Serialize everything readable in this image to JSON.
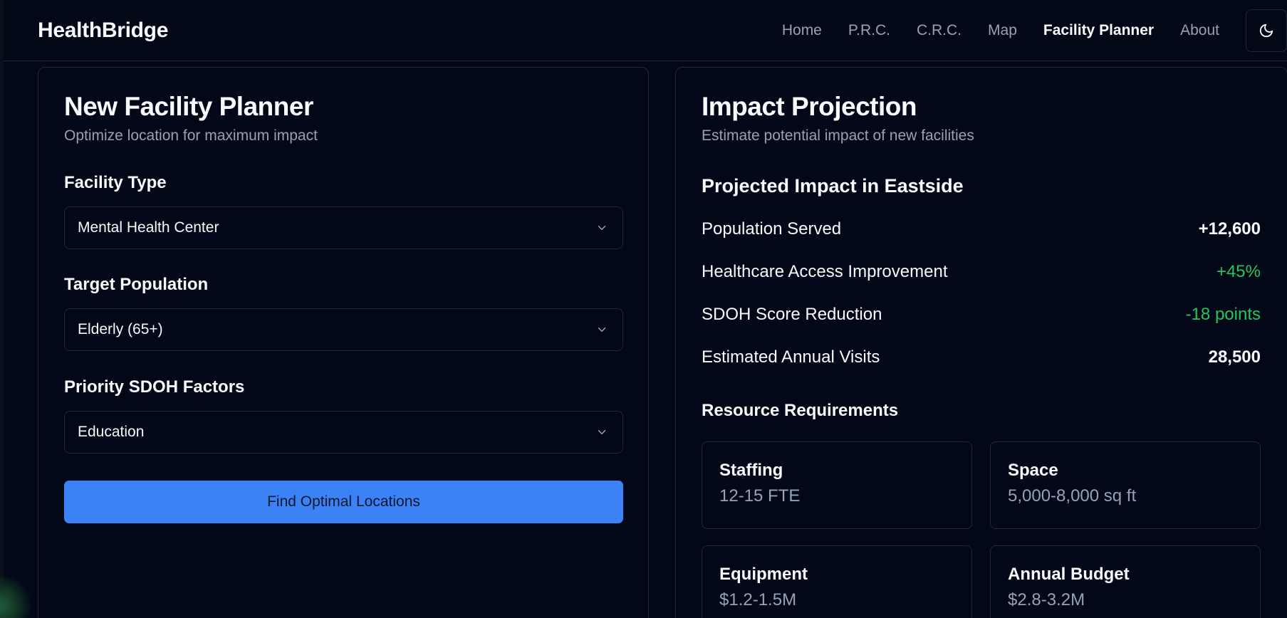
{
  "brand": "HealthBridge",
  "nav": {
    "items": [
      "Home",
      "P.R.C.",
      "C.R.C.",
      "Map",
      "Facility Planner",
      "About"
    ],
    "active": "Facility Planner"
  },
  "theme_toggle_icon": "moon-icon",
  "planner": {
    "title": "New Facility Planner",
    "subtitle": "Optimize location for maximum impact",
    "fields": [
      {
        "label": "Facility Type",
        "value": "Mental Health Center"
      },
      {
        "label": "Target Population",
        "value": "Elderly (65+)"
      },
      {
        "label": "Priority SDOH Factors",
        "value": "Education"
      }
    ],
    "button_label": "Find Optimal Locations"
  },
  "impact": {
    "title": "Impact Projection",
    "subtitle": "Estimate potential impact of new facilities",
    "section_title": "Projected Impact in Eastside",
    "metrics": [
      {
        "label": "Population Served",
        "value": "+12,600",
        "color": "#f8fafc"
      },
      {
        "label": "Healthcare Access Improvement",
        "value": "+45%",
        "color": "#22c55e"
      },
      {
        "label": "SDOH Score Reduction",
        "value": "-18 points",
        "color": "#22c55e"
      },
      {
        "label": "Estimated Annual Visits",
        "value": "28,500",
        "color": "#f8fafc"
      }
    ],
    "resources_title": "Resource Requirements",
    "resources": [
      {
        "title": "Staffing",
        "value": "12-15 FTE"
      },
      {
        "title": "Space",
        "value": "5,000-8,000 sq ft"
      },
      {
        "title": "Equipment",
        "value": "$1.2-1.5M"
      },
      {
        "title": "Annual Budget",
        "value": "$2.8-3.2M"
      }
    ]
  },
  "colors": {
    "background": "#020817",
    "border": "#1e293b",
    "accent": "#3b82f6",
    "positive": "#22c55e",
    "muted_text": "#94a3b8"
  }
}
